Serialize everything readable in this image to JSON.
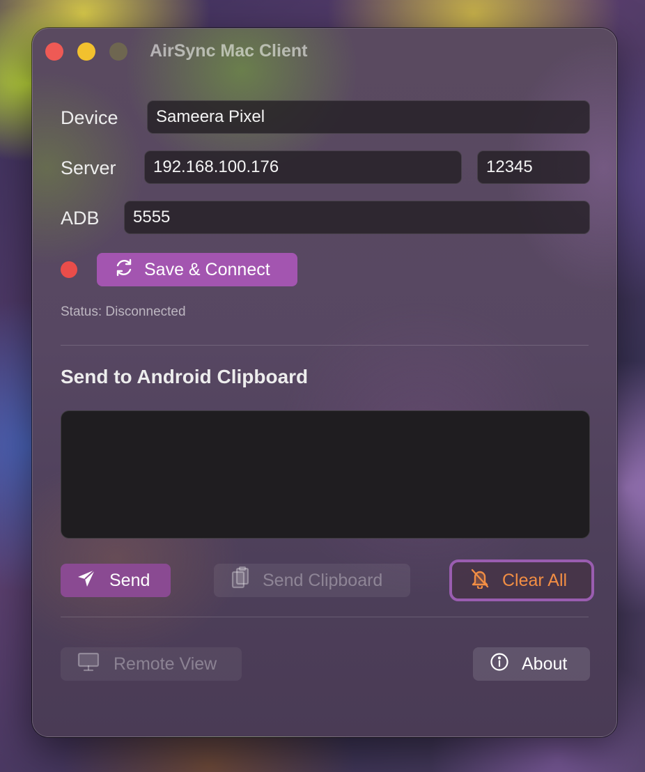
{
  "window": {
    "title": "AirSync Mac Client"
  },
  "form": {
    "device_label": "Device",
    "device_value": "Sameera Pixel",
    "server_label": "Server",
    "server_ip": "192.168.100.176",
    "server_port": "12345",
    "adb_label": "ADB",
    "adb_port": "5555"
  },
  "connection": {
    "status_color": "#ea4d4a",
    "connect_label": "Save & Connect",
    "connect_icon": "sync-icon",
    "status_text": "Status: Disconnected"
  },
  "clipboard": {
    "section_title": "Send to Android Clipboard",
    "text_value": "",
    "send_label": "Send",
    "send_icon": "paper-plane-icon",
    "send_clipboard_label": "Send Clipboard",
    "send_clipboard_icon": "clipboard-icon",
    "clear_all_label": "Clear All",
    "clear_all_icon": "bell-slash-icon"
  },
  "footer": {
    "remote_view_label": "Remote View",
    "remote_view_icon": "monitor-icon",
    "about_label": "About",
    "about_icon": "info-icon"
  },
  "colors": {
    "accent": "#a355b0",
    "warning": "#f28e44",
    "close": "#ee5a55",
    "minimize": "#f2c12e"
  }
}
